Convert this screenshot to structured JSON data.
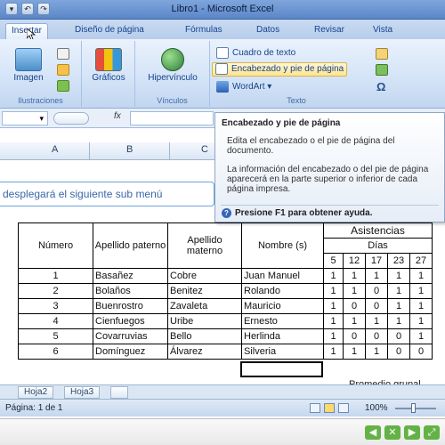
{
  "window": {
    "title": "Libro1 - Microsoft Excel"
  },
  "tabs": [
    {
      "label": "Insertar",
      "active": true
    },
    {
      "label": "Diseño de página"
    },
    {
      "label": "Fórmulas"
    },
    {
      "label": "Datos"
    },
    {
      "label": "Revisar"
    },
    {
      "label": "Vista"
    }
  ],
  "ribbon": {
    "imagen": "Imagen",
    "ilustraciones": "Ilustraciones",
    "graficos": "Gráficos",
    "hipervinculo": "Hipervínculo",
    "vinculos": "Vínculos",
    "cuadro_texto": "Cuadro de texto",
    "encabezado": "Encabezado y pie de página",
    "wordart": "WordArt",
    "texto": "Texto",
    "omega": "Ω"
  },
  "formula_bar": {
    "fx": "fx"
  },
  "columns": [
    "A",
    "B",
    "C"
  ],
  "callout": "desplegará el siguiente sub menú",
  "tooltip": {
    "title": "Encabezado y pie de página",
    "p1": "Edita el encabezado o el pie de página del documento.",
    "p2": "La información del encabezado o del pie de página aparecerá en la parte superior o inferior de cada página impresa.",
    "help": "Presione F1 para obtener ayuda."
  },
  "table": {
    "h_numero": "Número",
    "h_paterno": "Apellido paterno",
    "h_materno": "Apellido materno",
    "h_nombre": "Nombre (s)",
    "h_asistencias": "Asistencias",
    "h_dias": "Días",
    "days": [
      "5",
      "12",
      "17",
      "23",
      "27"
    ],
    "rows": [
      {
        "num": "1",
        "paterno": "Basañez",
        "materno": "Cobre",
        "nombre": "Juan Manuel",
        "a": [
          "1",
          "1",
          "1",
          "1",
          "1"
        ]
      },
      {
        "num": "2",
        "paterno": "Bolaños",
        "materno": "Benitez",
        "nombre": "Rolando",
        "a": [
          "1",
          "1",
          "0",
          "1",
          "1"
        ]
      },
      {
        "num": "3",
        "paterno": "Buenrostro",
        "materno": "Zavaleta",
        "nombre": "Mauricio",
        "a": [
          "1",
          "0",
          "0",
          "1",
          "1"
        ]
      },
      {
        "num": "4",
        "paterno": "Cienfuegos",
        "materno": "Uribe",
        "nombre": "Ernesto",
        "a": [
          "1",
          "1",
          "1",
          "1",
          "1"
        ]
      },
      {
        "num": "5",
        "paterno": "Covarruvias",
        "materno": "Bello",
        "nombre": "Herlinda",
        "a": [
          "1",
          "0",
          "0",
          "0",
          "1"
        ]
      },
      {
        "num": "6",
        "paterno": "Domínguez",
        "materno": "Álvarez",
        "nombre": "Silveria",
        "a": [
          "1",
          "1",
          "1",
          "0",
          "0"
        ]
      }
    ]
  },
  "promedio": "Promedio grupal",
  "sheets": [
    "Hoja2",
    "Hoja3"
  ],
  "status": {
    "page": "Página: 1 de 1",
    "zoom": "100%"
  }
}
